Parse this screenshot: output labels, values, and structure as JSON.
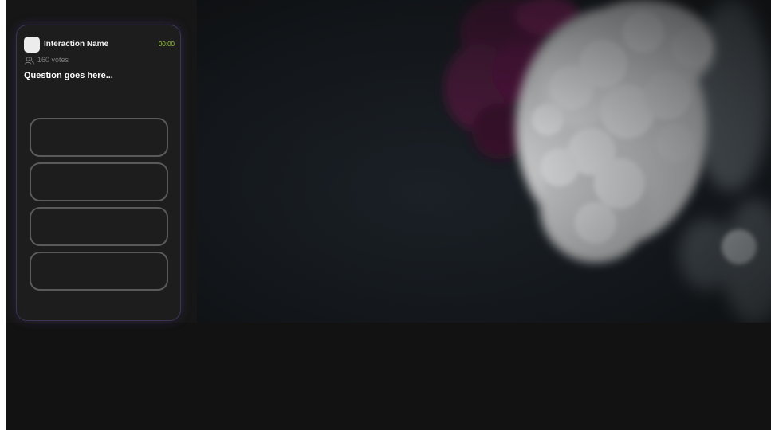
{
  "interaction": {
    "name": "Interaction Name",
    "timer": "00:00",
    "votes": "160 votes",
    "question": "Question goes here...",
    "options": [
      "",
      "",
      "",
      ""
    ]
  },
  "icons": {
    "app": "app-icon",
    "users": "users-icon"
  },
  "colors": {
    "background": "#121212",
    "card": "#1d1d1d",
    "card_border": "#3d3556",
    "timer": "#9ccb38",
    "option_border": "#5a5a5a",
    "ink_purple": "#6a1447",
    "ink_white": "#efefef"
  }
}
